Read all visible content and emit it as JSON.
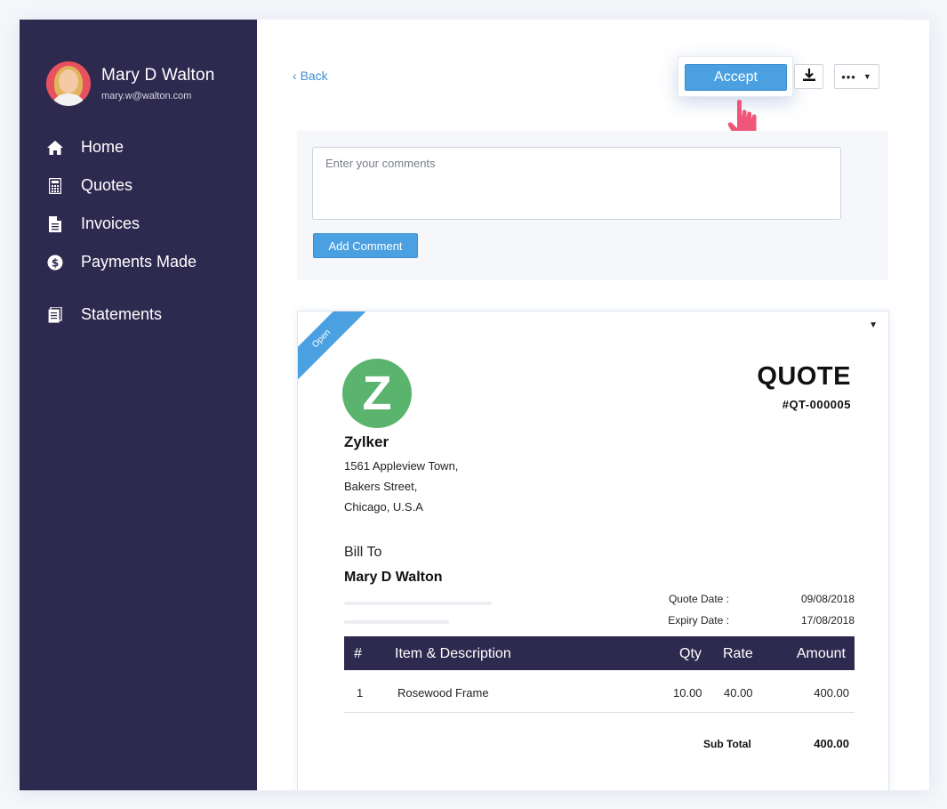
{
  "user": {
    "name": "Mary D Walton",
    "email": "mary.w@walton.com"
  },
  "sidebar": {
    "items": [
      {
        "label": "Home",
        "icon": "home-icon"
      },
      {
        "label": "Quotes",
        "icon": "calculator-icon"
      },
      {
        "label": "Invoices",
        "icon": "document-icon"
      },
      {
        "label": "Payments Made",
        "icon": "dollar-icon"
      },
      {
        "label": "Statements",
        "icon": "statements-icon"
      }
    ]
  },
  "toolbar": {
    "back_label": "Back",
    "accept_label": "Accept",
    "more_label": "•••"
  },
  "comments": {
    "placeholder": "Enter your comments",
    "add_label": "Add Comment"
  },
  "quote": {
    "status": "Open",
    "logo_letter": "Z",
    "company": "Zylker",
    "address": [
      "1561 Appleview Town,",
      "Bakers Street,",
      "Chicago, U.S.A"
    ],
    "title": "QUOTE",
    "number": "#QT-000005",
    "bill_to_label": "Bill To",
    "bill_to_name": "Mary D Walton",
    "quote_date_label": "Quote Date :",
    "quote_date": "09/08/2018",
    "expiry_date_label": "Expiry Date :",
    "expiry_date": "17/08/2018",
    "columns": {
      "num": "#",
      "item": "Item & Description",
      "qty": "Qty",
      "rate": "Rate",
      "amount": "Amount"
    },
    "items": [
      {
        "num": "1",
        "item": "Rosewood Frame",
        "qty": "10.00",
        "rate": "40.00",
        "amount": "400.00"
      }
    ],
    "subtotal_label": "Sub Total",
    "subtotal": "400.00"
  },
  "colors": {
    "sidebar": "#2e2a4f",
    "accent": "#4aa0e0",
    "logo": "#5ab46d",
    "cursor": "#f0557a"
  }
}
